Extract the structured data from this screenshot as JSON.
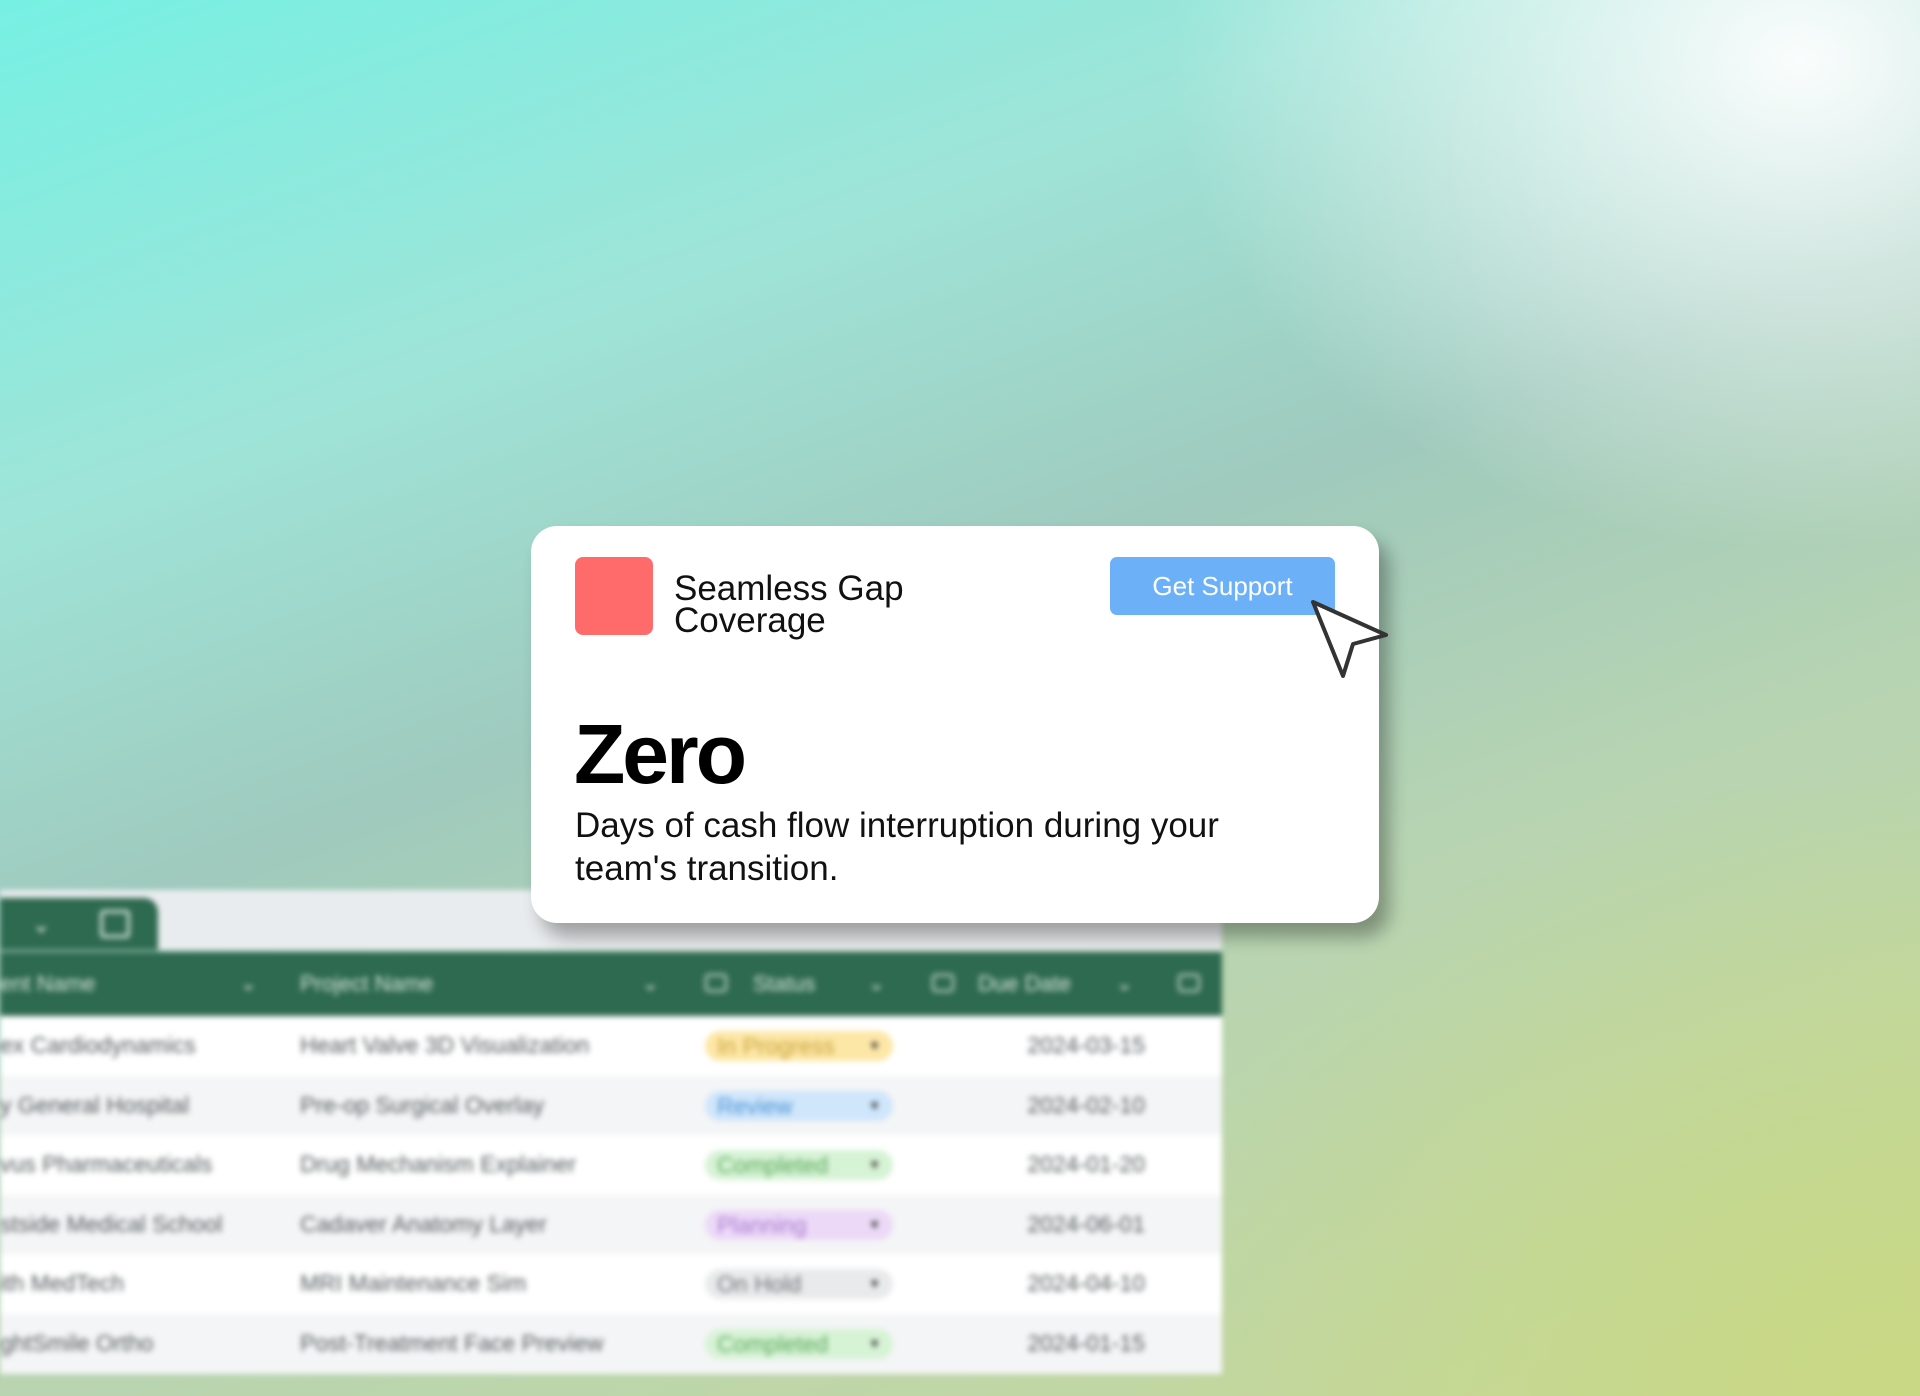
{
  "background_sheet": {
    "headers": {
      "client": "ent Name",
      "project": "Project Name",
      "status": "Status",
      "due_date": "Due Date"
    },
    "rows": [
      {
        "client": "ex Cardiodynamics",
        "project": "Heart Valve 3D Visualization",
        "status": "In Progress",
        "status_color": "#fde7a6",
        "status_text_color": "#c9a23a",
        "due": "2024-03-15"
      },
      {
        "client": "y General Hospital",
        "project": "Pre-op Surgical Overlay",
        "status": "Review",
        "status_color": "#cfe6fb",
        "status_text_color": "#4b93d6",
        "due": "2024-02-10"
      },
      {
        "client": "vus Pharmaceuticals",
        "project": "Drug Mechanism Explainer",
        "status": "Completed",
        "status_color": "#d6f3d5",
        "status_text_color": "#5aa85a",
        "due": "2024-01-20"
      },
      {
        "client": "stside Medical School",
        "project": "Cadaver Anatomy Layer",
        "status": "Planning",
        "status_color": "#ecd9f7",
        "status_text_color": "#a97ad0",
        "due": "2024-06-01"
      },
      {
        "client": "ith MedTech",
        "project": "MRI Maintenance Sim",
        "status": "On Hold",
        "status_color": "#e9eaeb",
        "status_text_color": "#6b7075",
        "due": "2024-04-10"
      },
      {
        "client": "ghtSmile Ortho",
        "project": "Post-Treatment Face Preview",
        "status": "Completed",
        "status_color": "#d6f3d5",
        "status_text_color": "#5aa85a",
        "due": "2024-01-15"
      }
    ]
  },
  "card": {
    "title": "Seamless Gap Coverage",
    "button_label": "Get Support",
    "stat_value": "Zero",
    "stat_caption": "Days of cash flow interruption during your team's transition.",
    "logo_color": "#ff6b6b",
    "button_color": "#6cb1f8"
  },
  "icons": {
    "cursor": "cursor-arrow-icon",
    "tab_chevron": "chevron-down-icon",
    "tab_doc": "document-icon",
    "status_header": "tag-icon",
    "due_header": "calendar-icon"
  }
}
